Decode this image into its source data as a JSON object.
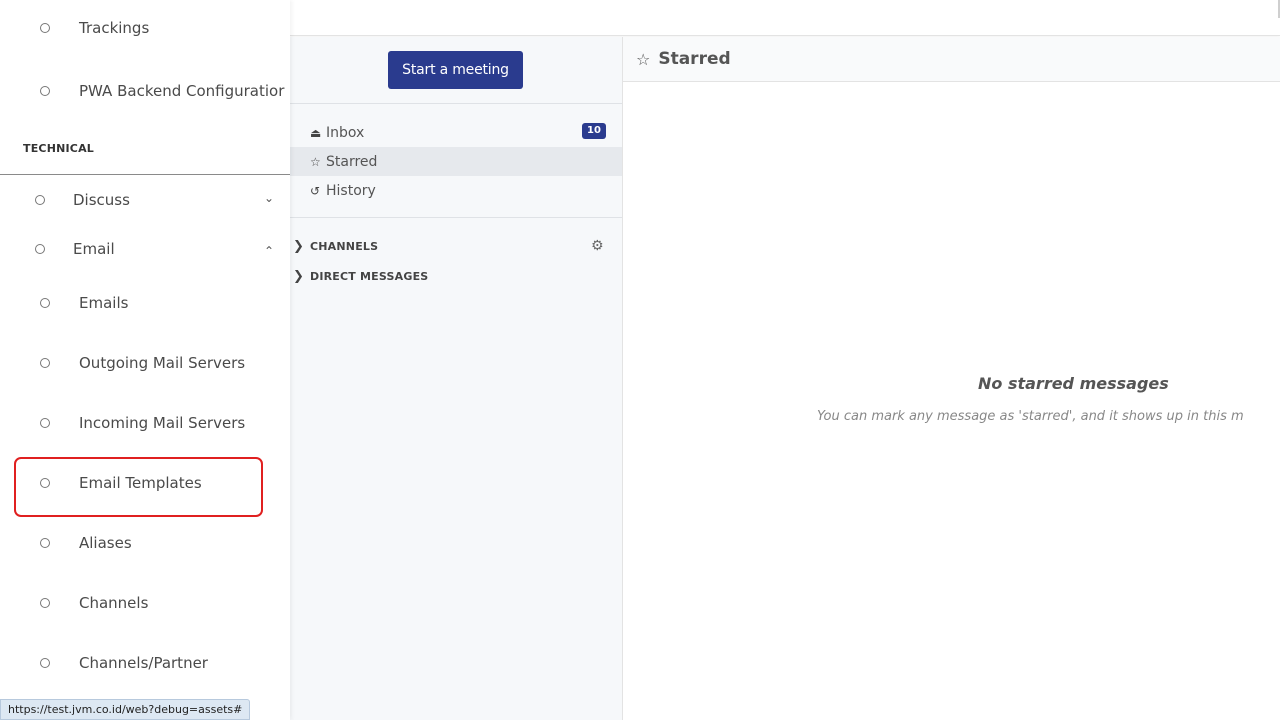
{
  "topbar": {},
  "discuss": {
    "start_meeting_label": "Start a meeting",
    "mailboxes": [
      {
        "icon": "inbox-icon",
        "glyph": "⏏",
        "label": "Inbox",
        "badge": "10"
      },
      {
        "icon": "star-icon",
        "glyph": "☆",
        "label": "Starred"
      },
      {
        "icon": "history-icon",
        "glyph": "↺",
        "label": "History"
      }
    ],
    "sections": [
      {
        "label": "CHANNELS"
      },
      {
        "label": "DIRECT MESSAGES"
      }
    ]
  },
  "main": {
    "header_title": "Starred",
    "empty_title": "No starred messages",
    "empty_subtitle": "You can mark any message as 'starred', and it shows up in this m"
  },
  "app_menu": {
    "items_top": [
      {
        "label": "Trackings"
      },
      {
        "label": "PWA Backend Configuratior"
      }
    ],
    "technical_label": "TECHNICAL",
    "groups": [
      {
        "label": "Discuss",
        "caret": "⌄"
      },
      {
        "label": "Email",
        "caret": "⌃"
      }
    ],
    "email_items": [
      {
        "label": "Emails"
      },
      {
        "label": "Outgoing Mail Servers"
      },
      {
        "label": "Incoming Mail Servers"
      },
      {
        "label": "Email Templates"
      },
      {
        "label": "Aliases"
      },
      {
        "label": "Channels"
      },
      {
        "label": "Channels/Partner"
      }
    ]
  },
  "status_url": "https://test.jvm.co.id/web?debug=assets#",
  "colors": {
    "primary": "#2a3b8e",
    "highlight": "#e02020"
  }
}
